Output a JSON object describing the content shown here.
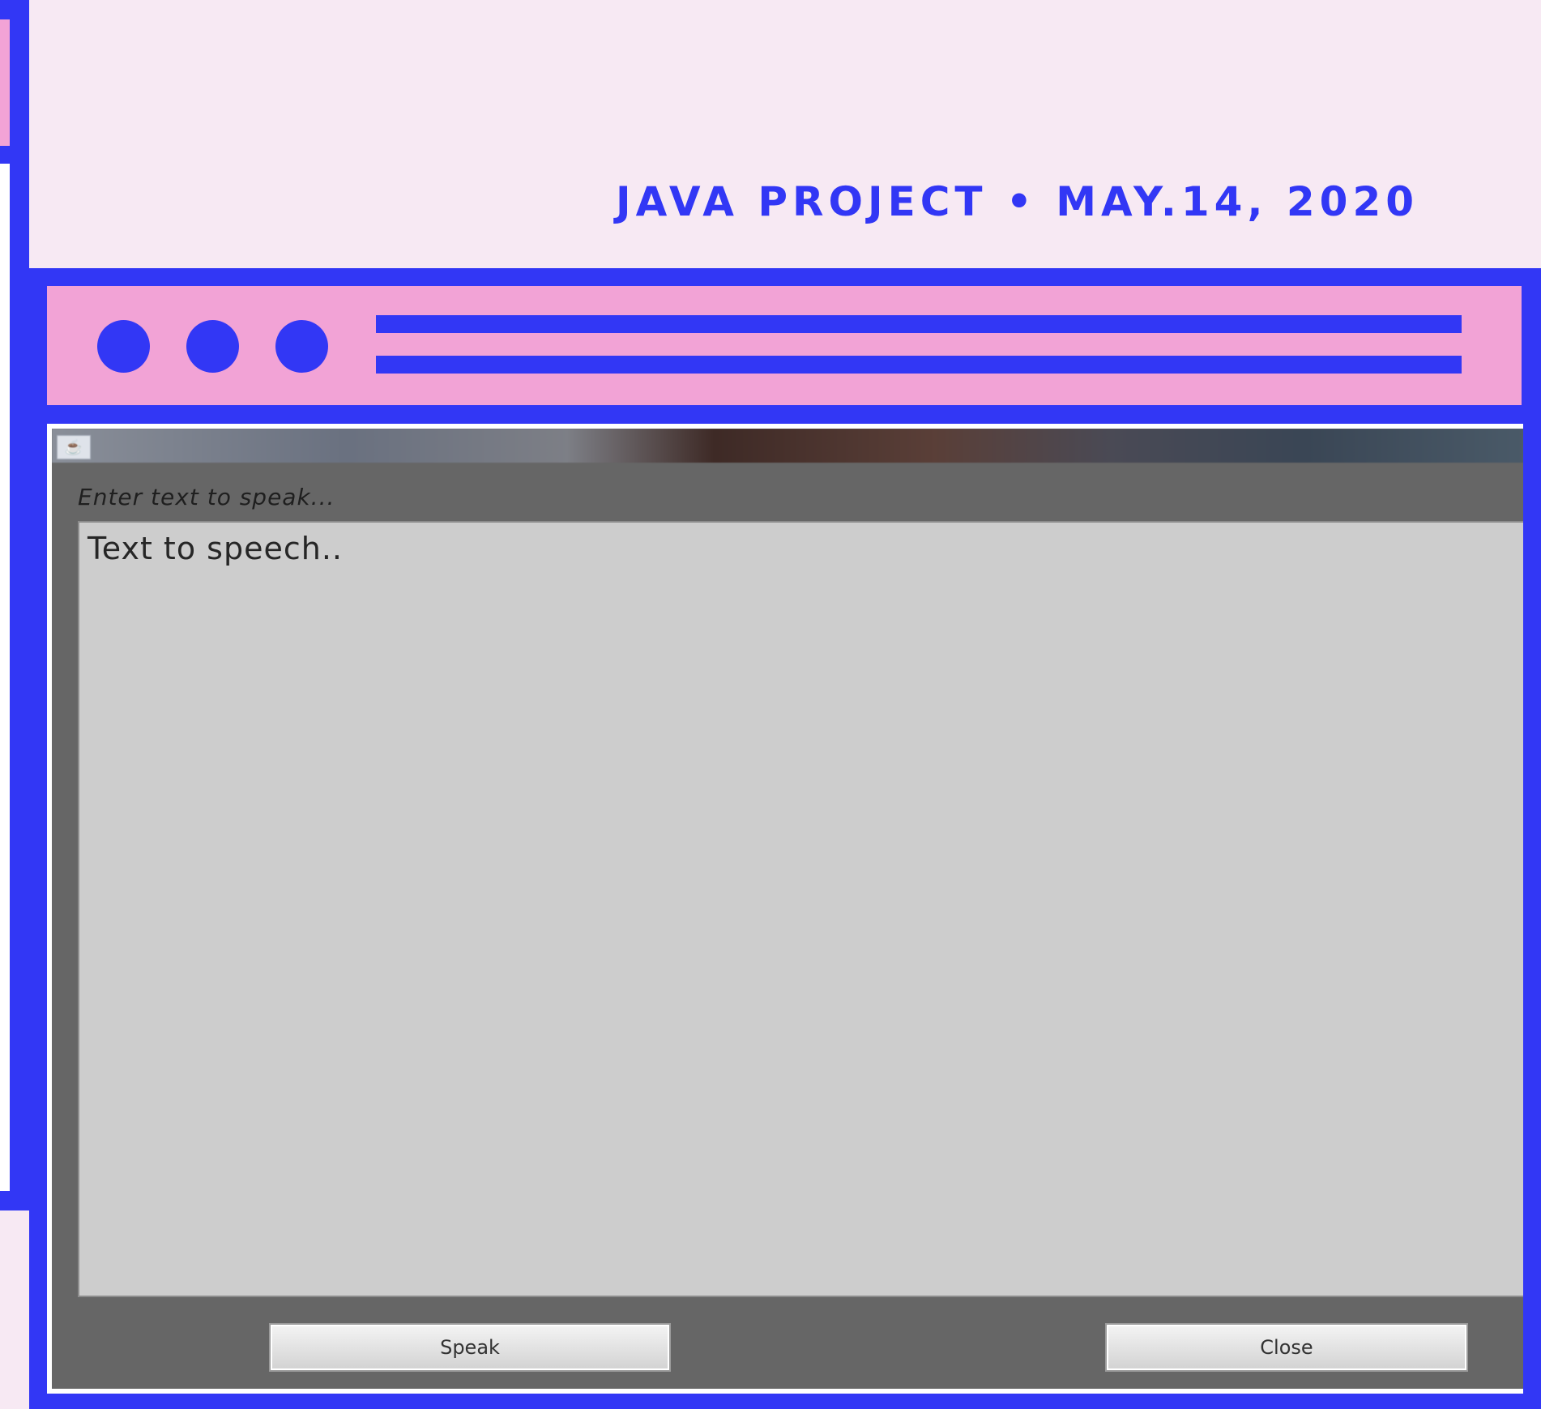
{
  "header": {
    "caption": "Java Project • May.14, 2020"
  },
  "browser_mock": {
    "dots": [
      "dot",
      "dot",
      "dot"
    ],
    "accent_color": "#3237f5",
    "bar_color": "#f2a3d6",
    "background_color": "#f7e9f3"
  },
  "app_window": {
    "title_icon": "java-app-icon",
    "prompt_label": "Enter text to speak...",
    "text_area_value": "Text to speech..",
    "buttons": {
      "speak": "Speak",
      "close": "Close"
    }
  }
}
